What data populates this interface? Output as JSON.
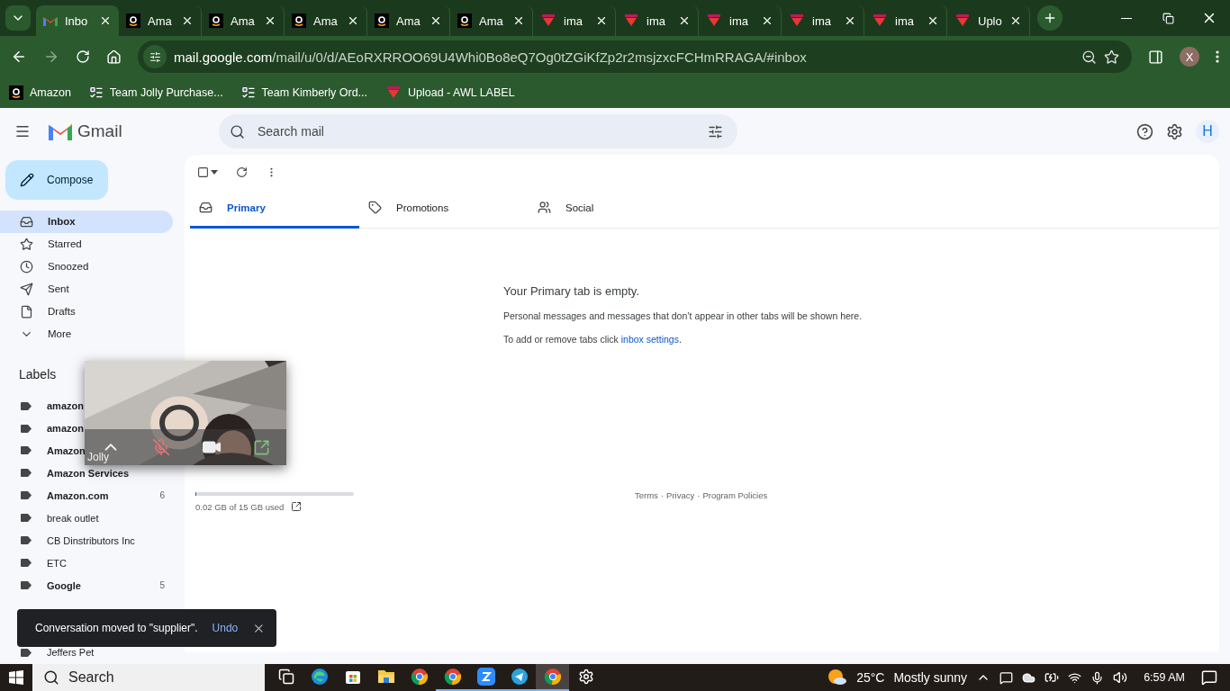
{
  "browser": {
    "tabs": [
      {
        "kind": "gmail",
        "title": "Inbo",
        "selected": true
      },
      {
        "kind": "amazon",
        "title": "Ama",
        "selected": false
      },
      {
        "kind": "amazon",
        "title": "Ama",
        "selected": false
      },
      {
        "kind": "amazon",
        "title": "Ama",
        "selected": false
      },
      {
        "kind": "amazon",
        "title": "Ama",
        "selected": false
      },
      {
        "kind": "amazon",
        "title": "Ama",
        "selected": false
      },
      {
        "kind": "awl",
        "title": "ima",
        "selected": false
      },
      {
        "kind": "awl",
        "title": "ima",
        "selected": false
      },
      {
        "kind": "awl",
        "title": "ima",
        "selected": false
      },
      {
        "kind": "awl",
        "title": "ima",
        "selected": false
      },
      {
        "kind": "awl",
        "title": "ima",
        "selected": false
      },
      {
        "kind": "awl",
        "title": "Uplo",
        "selected": false
      }
    ],
    "url": {
      "host": "mail.google.com",
      "path": "/mail/u/0/d/AEoRXRROO69U4Whi0Bo8eQ7Og0tZGiKfZp2r2msjzxcFCHmRRAGA/#inbox"
    },
    "profile": "X",
    "bookmarks": [
      {
        "kind": "amazon",
        "label": "Amazon"
      },
      {
        "kind": "forms",
        "label": "Team Jolly Purchase..."
      },
      {
        "kind": "forms",
        "label": "Team Kimberly Ord..."
      },
      {
        "kind": "awl",
        "label": "Upload - AWL LABEL"
      }
    ]
  },
  "gmail": {
    "logo": "Gmail",
    "search": {
      "placeholder": "Search mail"
    },
    "account": "H",
    "compose": "Compose",
    "nav": [
      {
        "kind": "inbox",
        "label": "Inbox",
        "selected": true
      },
      {
        "kind": "star",
        "label": "Starred",
        "selected": false
      },
      {
        "kind": "clock",
        "label": "Snoozed",
        "selected": false
      },
      {
        "kind": "send",
        "label": "Sent",
        "selected": false
      },
      {
        "kind": "file",
        "label": "Drafts",
        "selected": false
      },
      {
        "kind": "more",
        "label": "More",
        "selected": false
      }
    ],
    "labels_title": "Labels",
    "labels": [
      {
        "name": "amazon",
        "unread": true
      },
      {
        "name": "amazon",
        "unread": true
      },
      {
        "name": "Amazon",
        "unread": true
      },
      {
        "name": "Amazon Services",
        "unread": true
      },
      {
        "name": "Amazon.com",
        "count": "6",
        "unread": true
      },
      {
        "name": "break outlet",
        "unread": false
      },
      {
        "name": "CB Dinstributors Inc",
        "unread": false
      },
      {
        "name": "ETC",
        "unread": false
      },
      {
        "name": "Google",
        "count": "5",
        "unread": true
      },
      {
        "name": "Jeffers Pet",
        "unread": false
      }
    ],
    "select_all": {
      "checked": false
    },
    "tabs": [
      {
        "kind": "inbox",
        "label": "Primary",
        "selected": true
      },
      {
        "kind": "tag",
        "label": "Promotions",
        "selected": false
      },
      {
        "kind": "people",
        "label": "Social",
        "selected": false
      }
    ],
    "empty": {
      "title": "Your Primary tab is empty.",
      "text": "Personal messages and messages that don’t appear in other tabs will be shown here.",
      "hint": "To add or remove tabs click",
      "link": "inbox settings",
      "end": "."
    },
    "storage": {
      "level": 0.001,
      "text": "0.02 GB of 15 GB used"
    },
    "footer_links": [
      "Terms",
      "Privacy",
      "Program Policies"
    ],
    "footer_separator": "·",
    "toast": {
      "text": "Conversation moved to \"supplier\".",
      "action": "Undo"
    }
  },
  "video_call": {
    "kind": "picture",
    "name": "Jolly"
  },
  "taskbar": {
    "search": "Search",
    "apps": [
      {
        "kind": "taskview",
        "running": false,
        "selected": false
      },
      {
        "kind": "edge",
        "running": false,
        "selected": false
      },
      {
        "kind": "store",
        "running": false,
        "selected": false
      },
      {
        "kind": "folder",
        "running": false,
        "selected": false
      },
      {
        "kind": "chrome",
        "running": false,
        "selected": false
      },
      {
        "kind": "chrome",
        "running": true,
        "selected": false
      },
      {
        "kind": "zoom",
        "running": true,
        "selected": false
      },
      {
        "kind": "telegram",
        "running": true,
        "selected": false
      },
      {
        "kind": "chrome",
        "running": true,
        "selected": true
      },
      {
        "kind": "settings",
        "running": false,
        "selected": false
      }
    ],
    "temperature": "25°C",
    "weather": "Mostly sunny",
    "time": "6:59 AM"
  }
}
